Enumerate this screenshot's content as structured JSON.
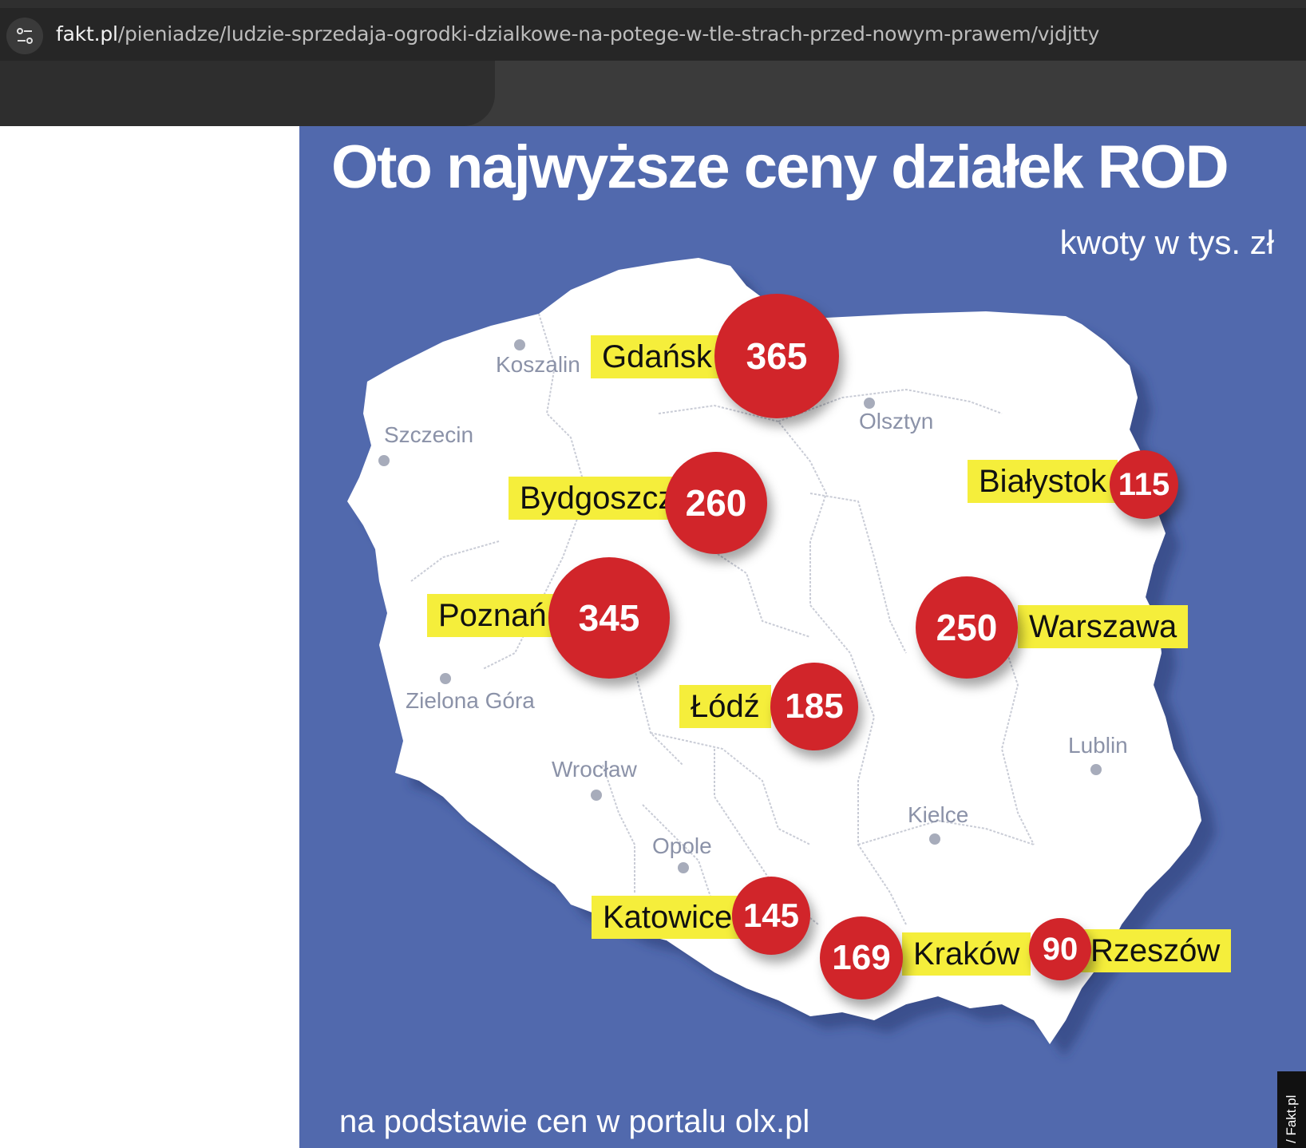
{
  "browser": {
    "url_host": "fakt.pl",
    "url_path": "/pieniadze/ludzie-sprzedaja-ogrodki-dzialkowe-na-potege-w-tle-strach-przed-nowym-prawem/vjdjtty",
    "site_info_icon": "tune-icon"
  },
  "infographic": {
    "title": "Oto najwyższe ceny działek ROD",
    "subtitle": "kwoty w tys. zł",
    "source": "na podstawie cen w portalu olx.pl",
    "credit": "/ Fakt.pl",
    "colors": {
      "background": "#5169ad",
      "map": "#ffffff",
      "bubble": "#d1252a",
      "label": "#f5ee3b"
    },
    "prices": [
      {
        "city": "Gdańsk",
        "value": "365"
      },
      {
        "city": "Bydgoszcz",
        "value": "260"
      },
      {
        "city": "Białystok",
        "value": "115"
      },
      {
        "city": "Poznań",
        "value": "345"
      },
      {
        "city": "Warszawa",
        "value": "250"
      },
      {
        "city": "Łódź",
        "value": "185"
      },
      {
        "city": "Katowice",
        "value": "145"
      },
      {
        "city": "Kraków",
        "value": "169"
      },
      {
        "city": "Rzeszów",
        "value": "90"
      }
    ],
    "other_cities": [
      "Koszalin",
      "Olsztyn",
      "Szczecin",
      "Zielona Góra",
      "Wrocław",
      "Lublin",
      "Kielce",
      "Opole"
    ]
  }
}
